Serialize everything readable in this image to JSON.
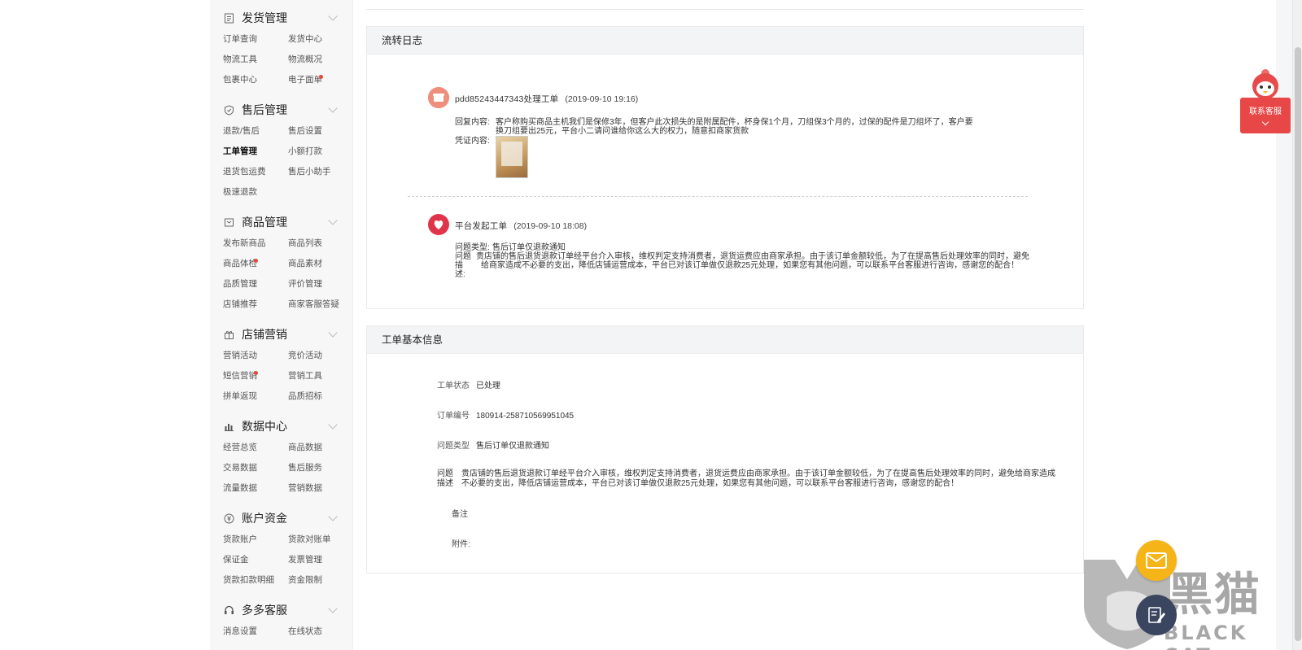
{
  "sidebar": {
    "groups": [
      {
        "title": "发货管理",
        "icon": "document-icon",
        "items": [
          "订单查询",
          "发货中心",
          "物流工具",
          "物流概况",
          "包裹中心",
          "电子面单"
        ]
      },
      {
        "title": "售后管理",
        "icon": "shield-icon",
        "items": [
          "退款/售后",
          "售后设置",
          "工单管理",
          "小额打款",
          "退货包运费",
          "售后小助手",
          "极速退款"
        ]
      },
      {
        "title": "商品管理",
        "icon": "box-icon",
        "items": [
          "发布新商品",
          "商品列表",
          "商品体检",
          "商品素材",
          "品质管理",
          "评价管理",
          "店铺推荐",
          "商家客服答疑"
        ]
      },
      {
        "title": "店铺营销",
        "icon": "gift-icon",
        "items": [
          "营销活动",
          "竞价活动",
          "短信营销",
          "营销工具",
          "拼单返现",
          "品质招标"
        ]
      },
      {
        "title": "数据中心",
        "icon": "bar-chart-icon",
        "items": [
          "经营总览",
          "商品数据",
          "交易数据",
          "售后服务",
          "流量数据",
          "营销数据"
        ]
      },
      {
        "title": "账户资金",
        "icon": "yuan-icon",
        "items": [
          "货款账户",
          "货款对账单",
          "保证金",
          "发票管理",
          "货款扣款明细",
          "资金限制"
        ]
      },
      {
        "title": "多多客服",
        "icon": "headset-icon",
        "items": [
          "消息设置",
          "在线状态"
        ]
      }
    ],
    "active_item": "工单管理"
  },
  "flow_log": {
    "title": "流转日志",
    "entries": [
      {
        "actor": "pdd85243447343处理工单",
        "time": "(2019-09-10 19:16)",
        "reply_label": "回复内容:",
        "reply_line1": "客户称购买商品主机我们是保修3年，但客户此次损失的是附属配件，杯身保1个月，刀组保3个月的，过保的配件是刀组坏了，客户要",
        "reply_line2": "换刀组要出25元，平台小二请问谁给你这么大的权力，随意扣商家货款",
        "evidence_label": "凭证内容:"
      },
      {
        "actor": "平台发起工单",
        "time": "(2019-09-10 18:08)",
        "type_label": "问题类型:",
        "type_value": "售后订单仅退款通知",
        "desc_label_1": "问题",
        "desc_label_2": "描",
        "desc_label_3": "述:",
        "desc_line1": "贵店铺的售后退货退款订单经平台介入审核，维权判定支持消费者，退货运费应由商家承担。由于该订单金额较低，为了在提高售后处理效率的同时，避免",
        "desc_line2": "给商家造成不必要的支出，降低店铺运营成本，平台已对该订单做仅退款25元处理，如果您有其他问题，可以联系平台客服进行咨询，感谢您的配合！"
      }
    ]
  },
  "basic_info": {
    "title": "工单基本信息",
    "status_label": "工单状态",
    "status_value": "已处理",
    "order_label": "订单编号",
    "order_value": "180914-258710569951045",
    "type_label": "问题类型",
    "type_value": "售后订单仅退款通知",
    "desc_label_1": "问题",
    "desc_label_2": "描述",
    "desc_line1": "贵店铺的售后退货退款订单经平台介入审核，维权判定支持消费者，退货运费应由商家承担。由于该订单金额较低，为了在提高售后处理效率的同时，避免给商家造成",
    "desc_line2": "不必要的支出，降低店铺运营成本，平台已对该订单做仅退款25元处理，如果您有其他问题，可以联系平台客服进行咨询，感谢您的配合！",
    "note_label": "备注",
    "attachment_label": "附件:"
  },
  "widgets": {
    "contact_service": "联系客服",
    "watermark_cn": "黑猫",
    "watermark_en": "BLACK CAT"
  },
  "colors": {
    "accent_red": "#e84747",
    "mail_yellow": "#f5b417",
    "badge_dot": "#e8463a"
  }
}
